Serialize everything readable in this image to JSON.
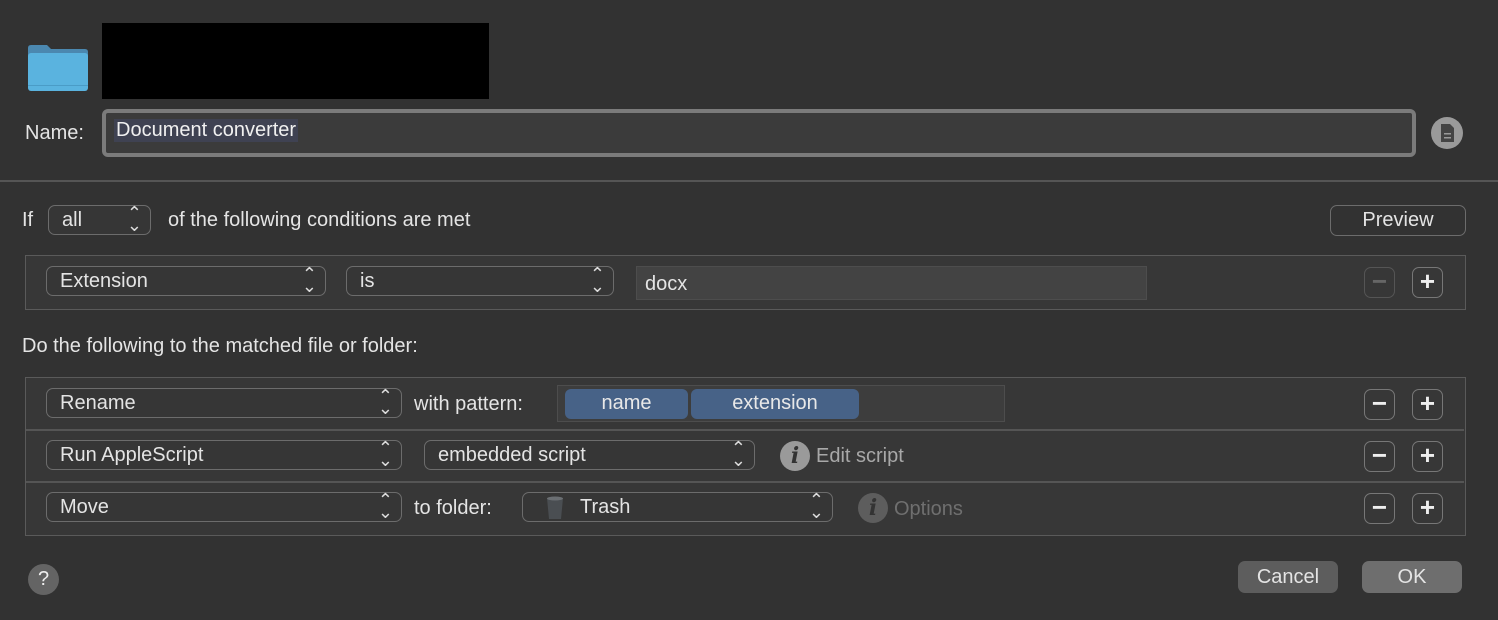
{
  "header": {
    "name_label": "Name:",
    "name_value": "Document converter"
  },
  "conditions": {
    "prefix": "If",
    "match_select": "all",
    "suffix": "of the following conditions are met",
    "preview_button": "Preview",
    "rows": [
      {
        "attribute": "Extension",
        "operator": "is",
        "value": "docx"
      }
    ]
  },
  "actions": {
    "title": "Do the following to the matched file or folder:",
    "rows": [
      {
        "action": "Rename",
        "label": "with pattern:",
        "tokens": [
          "name",
          "extension"
        ]
      },
      {
        "action": "Run AppleScript",
        "option": "embedded script",
        "link": "Edit script"
      },
      {
        "action": "Move",
        "label": "to folder:",
        "option": "Trash",
        "link": "Options"
      }
    ]
  },
  "footer": {
    "help": "?",
    "cancel": "Cancel",
    "ok": "OK"
  },
  "colors": {
    "background": "#323232",
    "token": "#476287",
    "name_selection": "#3f4252"
  }
}
